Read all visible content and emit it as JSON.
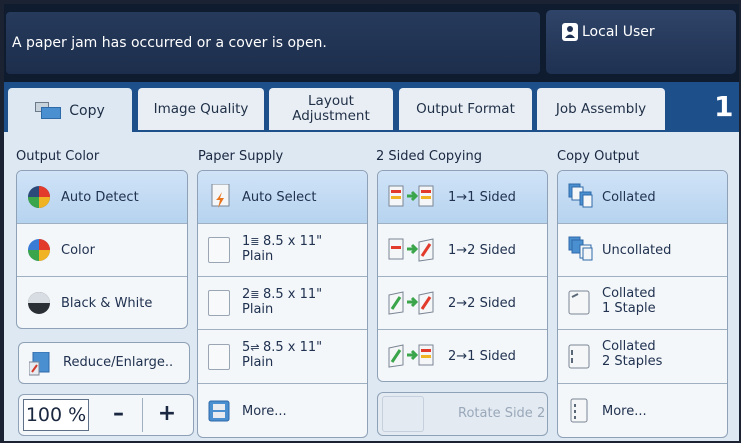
{
  "status": {
    "message": "A paper jam has occurred or a cover is open.",
    "user": "Local User"
  },
  "tabs": {
    "copy": "Copy",
    "image_quality": "Image Quality",
    "layout_line1": "Layout",
    "layout_line2": "Adjustment",
    "output_format": "Output Format",
    "job_assembly": "Job Assembly",
    "copy_count": "1"
  },
  "output_color": {
    "heading": "Output Color",
    "items": [
      "Auto Detect",
      "Color",
      "Black & White"
    ],
    "reduce_enlarge": "Reduce/Enlarge..",
    "zoom_value": "100 %",
    "minus": "–",
    "plus": "+"
  },
  "paper_supply": {
    "heading": "Paper Supply",
    "auto": "Auto Select",
    "trays": [
      {
        "num": "1",
        "size": "8.5 x 11\"",
        "type": "Plain"
      },
      {
        "num": "2",
        "size": "8.5 x 11\"",
        "type": "Plain"
      },
      {
        "num": "5",
        "size": "8.5 x 11\"",
        "type": "Plain"
      }
    ],
    "more": "More..."
  },
  "two_sided": {
    "heading": "2 Sided Copying",
    "items": [
      "1→1 Sided",
      "1→2 Sided",
      "2→2 Sided",
      "2→1 Sided"
    ],
    "rotate": "Rotate Side 2"
  },
  "copy_output": {
    "heading": "Copy Output",
    "collated": "Collated",
    "uncollated": "Uncollated",
    "staple1_line1": "Collated",
    "staple1_line2": "1 Staple",
    "staple2_line1": "Collated",
    "staple2_line2": "2 Staples",
    "more": "More..."
  }
}
